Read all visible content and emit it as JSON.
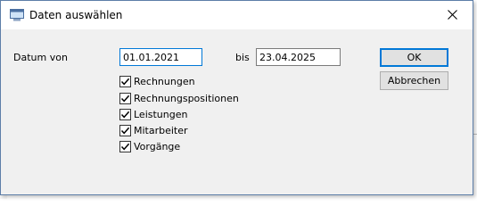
{
  "window": {
    "title": "Daten auswählen"
  },
  "form": {
    "date_from_label": "Datum von",
    "date_from_value": "01.01.2021",
    "date_to_label": "bis",
    "date_to_value": "23.04.2025"
  },
  "buttons": {
    "ok": "OK",
    "cancel": "Abbrechen"
  },
  "checkboxes": [
    {
      "label": "Rechnungen",
      "checked": true
    },
    {
      "label": "Rechnungspositionen",
      "checked": true
    },
    {
      "label": "Leistungen",
      "checked": true
    },
    {
      "label": "Mitarbeiter",
      "checked": true
    },
    {
      "label": "Vorgänge",
      "checked": true
    }
  ],
  "colors": {
    "accent": "#0078d7",
    "dialog_bg": "#f0f0f0"
  }
}
